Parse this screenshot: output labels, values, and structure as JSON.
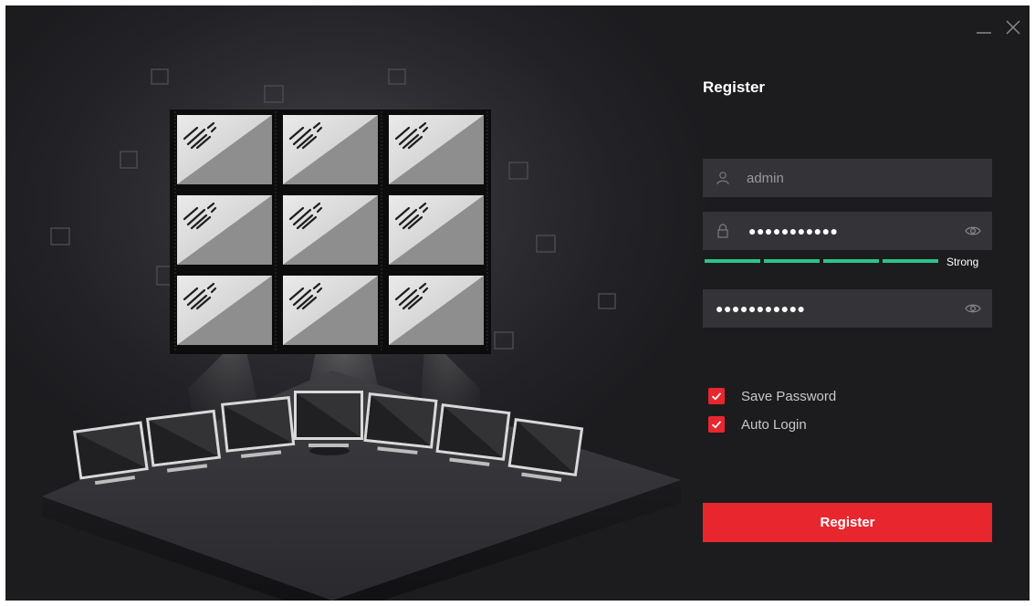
{
  "window": {
    "minimize_icon": "minimize-icon",
    "close_icon": "close-icon"
  },
  "register": {
    "title": "Register",
    "username_value": "admin",
    "password_masked": "●●●●●●●●●●●",
    "confirm_masked": "●●●●●●●●●●●",
    "strength_label": "Strong",
    "strength_level": "4/4",
    "strength_color": "#2cc488",
    "save_password_label": "Save Password",
    "save_password_checked": true,
    "auto_login_label": "Auto Login",
    "auto_login_checked": true,
    "button_label": "Register"
  },
  "colors": {
    "accent": "#e8262e",
    "field_bg": "#343438",
    "background": "#26262a"
  },
  "icons": {
    "user": "user-icon",
    "lock": "lock-icon",
    "eye": "eye-icon",
    "check": "check-icon"
  }
}
